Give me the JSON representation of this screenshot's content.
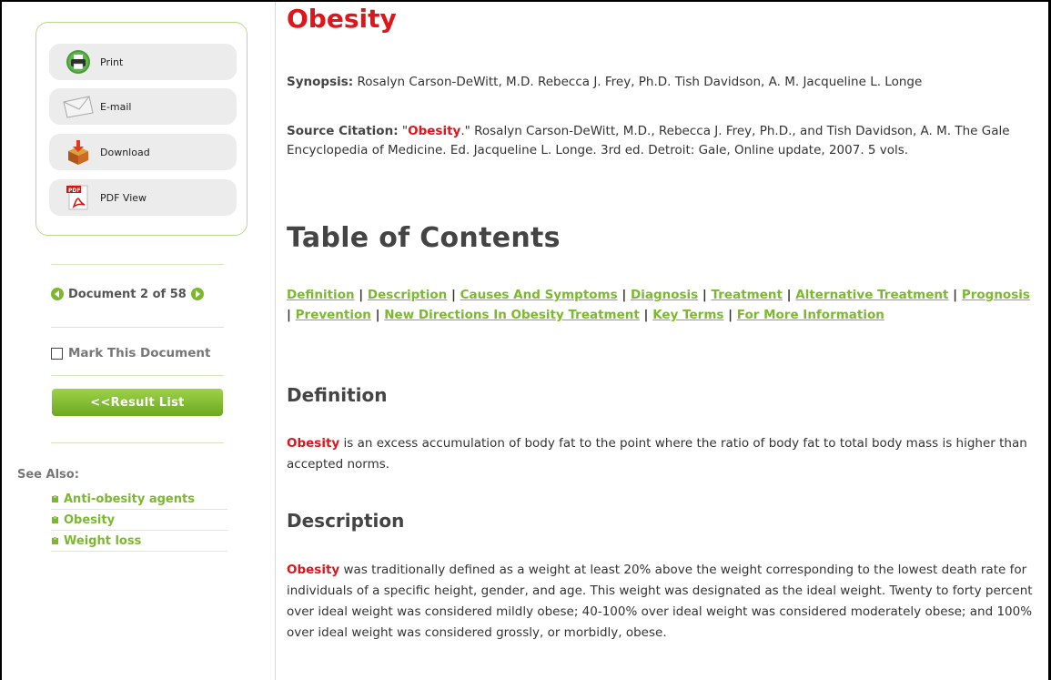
{
  "sidebar": {
    "tools": {
      "print_label": "Print",
      "email_label": "E-mail",
      "download_label": "Download",
      "pdf_label": "PDF View"
    },
    "document_nav": {
      "label": "Document 2 of 58"
    },
    "mark_document_label": "Mark This Document",
    "result_list_label": "<<Result List",
    "see_also": {
      "heading": "See Also:",
      "items": [
        {
          "label": "Anti-obesity agents"
        },
        {
          "label": "Obesity"
        },
        {
          "label": "Weight loss"
        }
      ]
    }
  },
  "article": {
    "title": "Obesity",
    "synopsis_label": "Synopsis:",
    "synopsis_text": "Rosalyn Carson-DeWitt, M.D. Rebecca J. Frey, Ph.D. Tish Davidson, A. M. Jacqueline L. Longe",
    "citation_label": "Source Citation:",
    "citation_open_quote": "\"",
    "citation_term": "Obesity",
    "citation_text": ".\" Rosalyn Carson-DeWitt, M.D., Rebecca J. Frey, Ph.D., and Tish Davidson, A. M. The Gale Encyclopedia of Medicine. Ed. Jacqueline L. Longe. 3rd ed. Detroit: Gale, Online update, 2007. 5 vols.",
    "toc_heading": "Table of Contents",
    "toc_links": [
      {
        "label": "Definition"
      },
      {
        "label": "Description"
      },
      {
        "label": "Causes And Symptoms"
      },
      {
        "label": "Diagnosis"
      },
      {
        "label": "Treatment"
      },
      {
        "label": "Alternative Treatment"
      },
      {
        "label": "Prognosis"
      },
      {
        "label": "Prevention"
      },
      {
        "label": "New Directions In Obesity Treatment"
      },
      {
        "label": "Key Terms"
      },
      {
        "label": "For More Information"
      }
    ],
    "toc_separator": " | ",
    "definition_heading": "Definition",
    "definition_term": "Obesity",
    "definition_text": " is an excess accumulation of body fat to the point where the ratio of body fat to total body mass is higher than accepted norms.",
    "description_heading": "Description",
    "description_term": "Obesity",
    "description_text": " was traditionally defined as a weight at least 20% above the weight corresponding to the lowest death rate for individuals of a specific height, gender, and age. This weight was designated as the ideal weight. Twenty to forty percent over ideal weight was considered mildly obese; 40-100% over ideal weight was considered moderately obese; and 100% over ideal weight was considered grossly, or morbidly, obese."
  },
  "colors": {
    "accent_green": "#7cb82f",
    "title_red": "#e0141a",
    "heading_gray": "#444444"
  },
  "icons": [
    "printer-icon",
    "envelope-icon",
    "download-box-icon",
    "pdf-icon",
    "prev-arrow-icon",
    "next-arrow-icon",
    "checkbox-icon",
    "bullet-icon"
  ]
}
